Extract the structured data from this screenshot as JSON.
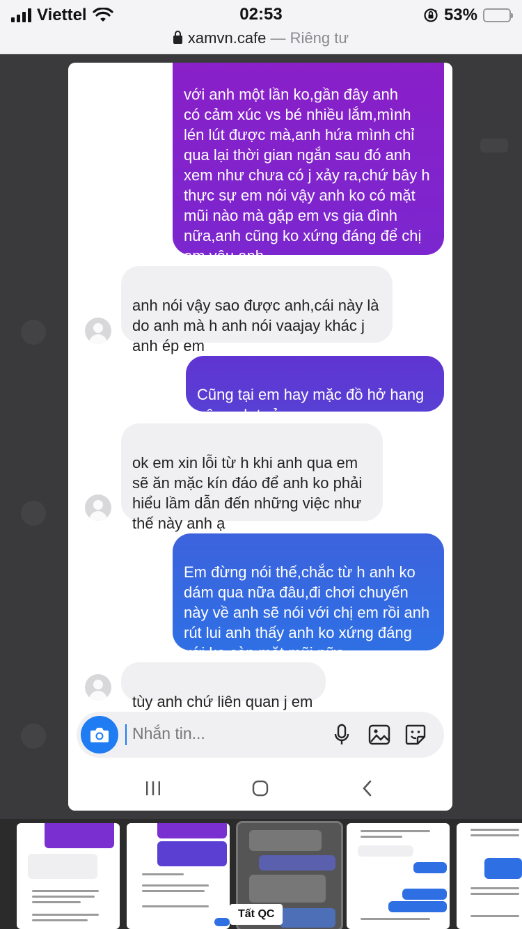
{
  "status_bar": {
    "carrier": "Viettel",
    "time": "02:53",
    "battery_percent": "53%",
    "battery_level": 0.53,
    "icons": [
      "signal-icon",
      "wifi-icon",
      "rotation-lock-icon",
      "battery-icon"
    ]
  },
  "url_bar": {
    "domain": "xamvn.cafe",
    "separator": " — ",
    "label": "Riêng tư"
  },
  "messages": [
    {
      "side": "sent",
      "text": "với anh một lần ko,gần đây anh\ncó cảm xúc vs bé nhiều lắm,mình\nlén lút được mà,anh hứa mình chỉ\nqua lại thời gian ngắn sau đó anh\nxem như chưa có j xảy ra,chứ bây h\nthực sự em nói vậy anh ko có mặt\nmũi nào mà gặp em vs gia đình\nnữa,anh cũng ko xứng đáng để chị\nem yêu anh"
    },
    {
      "side": "recv",
      "text": "anh nói vậy sao được anh,cái này là\ndo anh mà h anh nói vaajay khác j\nanh ép em"
    },
    {
      "side": "sent",
      "text": "Cũng tại em hay mặc đồ hở hang\nnên anh tưởng"
    },
    {
      "side": "recv",
      "text": "ok em xin lỗi từ h khi anh qua em\nsẽ ăn mặc kín đáo để anh ko phải\nhiểu lầm dẫn đến những việc như\nthế này anh ạ"
    },
    {
      "side": "sent",
      "text": "Em đừng nói thế,chắc từ h anh ko\ndám qua nữa đâu,đi chơi chuyến\nnày về anh sẽ nói với chị em rồi anh\nrút lui anh thấy anh ko xứng đáng\nvới ko còn mặt mũi nữa"
    },
    {
      "side": "recv",
      "text": "tùy anh chứ liên quan j em"
    }
  ],
  "composer": {
    "placeholder": "Nhắn tin...",
    "icons": [
      "camera-icon",
      "microphone-icon",
      "gallery-icon",
      "sticker-icon"
    ]
  },
  "nav_bar": {
    "icons": [
      "recent-apps-icon",
      "home-icon",
      "back-icon"
    ]
  },
  "thumbnail_strip": {
    "ad_label": "Tất QC",
    "thumbnails": 5
  },
  "colors": {
    "sent_gradient_top": "#8a1fc8",
    "sent_mid": "#5b3fd0",
    "sent_bottom": "#2f6fe4",
    "received_bg": "#f0f0f2",
    "camera_button": "#1f7cf2"
  }
}
